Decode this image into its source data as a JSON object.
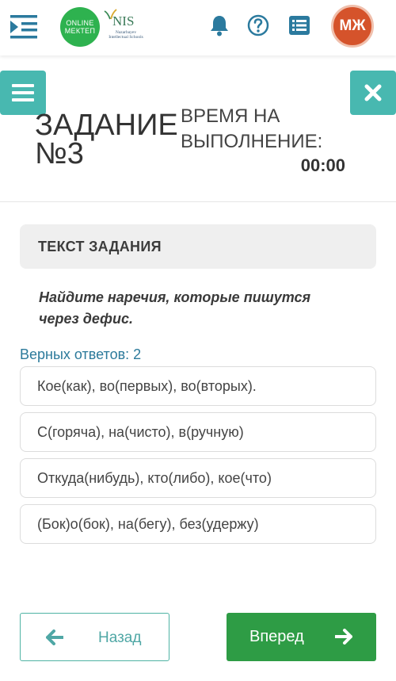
{
  "header": {
    "logo_online_line1": "ONLINE",
    "logo_online_line2": "МЕКТЕП",
    "logo_nis_text": "NIS",
    "logo_nis_sub": "Nazarbayev Intellectual Schools",
    "avatar_initials": "МЖ"
  },
  "task": {
    "title_line1": "ЗАДАНИЕ",
    "title_line2": "№3",
    "time_label_line1": "ВРЕМЯ НА",
    "time_label_line2": "ВЫПОЛНЕНИЕ:",
    "timer": "00:00",
    "section_header": "ТЕКСТ ЗАДАНИЯ",
    "question_line1": "Найдите наречия, которые пишутся",
    "question_line2": "через дефис.",
    "correct_count": "Верных ответов: 2",
    "options": [
      {
        "label": "Кое(как), во(первых), во(вторых)."
      },
      {
        "label": "С(горяча), на(чисто), в(ручную)"
      },
      {
        "label": "Откуда(нибудь), кто(либо), кое(что)"
      },
      {
        "label": "(Бок)о(бок), на(бегу), без(удержу)"
      }
    ]
  },
  "navigation": {
    "back_label": "Назад",
    "next_label": "Вперед"
  },
  "icons": {
    "menu_toggle": "indent-menu-icon",
    "bell": "bell-icon",
    "help": "question-icon",
    "list": "list-icon",
    "sidebar_menu": "hamburger-icon",
    "close": "close-icon",
    "back_arrow": "arrow-left-icon",
    "next_arrow": "arrow-right-icon"
  },
  "colors": {
    "teal": "#48b8b0",
    "green": "#2e9c45",
    "avatar": "#d5532b",
    "link_blue": "#2c7a9b"
  }
}
